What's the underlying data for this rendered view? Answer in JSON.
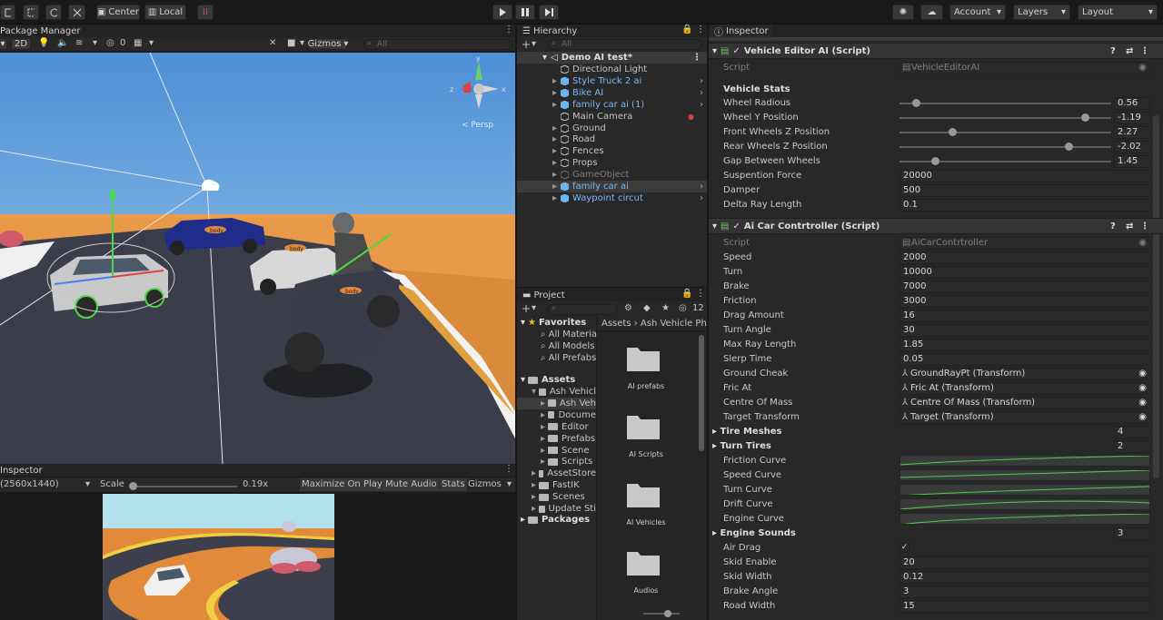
{
  "toolbar": {
    "center": "Center",
    "local": "Local",
    "account": "Account",
    "layers": "Layers",
    "layout": "Layout"
  },
  "scene": {
    "tab": "Package Manager",
    "mode2d": "2D",
    "gizmos": "Gizmos",
    "search": "All",
    "hidden_count": "0",
    "persp": "< Persp",
    "axis_x": "x",
    "axis_y": "y",
    "axis_z": "z",
    "car_label": "body"
  },
  "game": {
    "tab": "Inspector",
    "resolution": "(2560x1440)",
    "scale_label": "Scale",
    "scale_value": "0.19x",
    "maximize": "Maximize On Play",
    "mute": "Mute Audio",
    "stats": "Stats",
    "gizmos": "Gizmos"
  },
  "hierarchy": {
    "tab": "Hierarchy",
    "search": "All",
    "scene": "Demo AI test*",
    "items": [
      {
        "label": "Directional Light",
        "type": "go",
        "expand": false
      },
      {
        "label": "Style Truck 2 ai",
        "type": "prefab",
        "expand": true
      },
      {
        "label": "Bike AI",
        "type": "prefab",
        "expand": true
      },
      {
        "label": "family car ai (1)",
        "type": "prefab",
        "expand": true
      },
      {
        "label": "Main Camera",
        "type": "go",
        "expand": false
      },
      {
        "label": "Ground",
        "type": "go",
        "expand": true
      },
      {
        "label": "Road",
        "type": "go",
        "expand": true
      },
      {
        "label": "Fences",
        "type": "go",
        "expand": true
      },
      {
        "label": "Props",
        "type": "go",
        "expand": true
      },
      {
        "label": "GameObject",
        "type": "inactive",
        "expand": true
      },
      {
        "label": "family car ai",
        "type": "prefab",
        "expand": true
      },
      {
        "label": "Waypoint circut",
        "type": "prefab",
        "expand": true
      }
    ]
  },
  "project": {
    "tab": "Project",
    "count": "12",
    "favorites": "Favorites",
    "fav_items": [
      "All Materia",
      "All Models",
      "All Prefabs"
    ],
    "assets": "Assets",
    "tree": [
      {
        "label": "Ash Vehicl",
        "indent": 1
      },
      {
        "label": "Ash Veh",
        "indent": 2
      },
      {
        "label": "Docume",
        "indent": 2
      },
      {
        "label": "Editor",
        "indent": 2
      },
      {
        "label": "Prefabs",
        "indent": 2
      },
      {
        "label": "Scene",
        "indent": 2
      },
      {
        "label": "Scripts",
        "indent": 2
      },
      {
        "label": "AssetStore",
        "indent": 1
      },
      {
        "label": "FastIK",
        "indent": 1
      },
      {
        "label": "Scenes",
        "indent": 1
      },
      {
        "label": "Update Sti",
        "indent": 1
      }
    ],
    "packages": "Packages",
    "breadcrumb": [
      "Assets",
      "Ash Vehicle Ph"
    ],
    "folders": [
      "AI prefabs",
      "AI Scripts",
      "AI Vehicles",
      "Audios"
    ]
  },
  "inspector": {
    "tab": "Inspector",
    "comp1": {
      "title": "Vehicle Editor AI (Script)",
      "script_label": "Script",
      "script": "VehicleEditorAI",
      "section": "Vehicle Stats",
      "sliders": [
        {
          "label": "Wheel Radious",
          "value": "0.56",
          "pos": 0.06
        },
        {
          "label": "Wheel Y Position",
          "value": "-1.19",
          "pos": 0.86
        },
        {
          "label": "Front Wheels Z Position",
          "value": "2.27",
          "pos": 0.23
        },
        {
          "label": "Rear Wheels Z Position",
          "value": "-2.02",
          "pos": 0.78
        },
        {
          "label": "Gap Between Wheels",
          "value": "1.45",
          "pos": 0.15
        }
      ],
      "fields": [
        {
          "label": "Suspention Force",
          "value": "20000"
        },
        {
          "label": "Damper",
          "value": "500"
        },
        {
          "label": "Delta Ray Length",
          "value": "0.1"
        }
      ]
    },
    "comp2": {
      "title": "Ai Car Contrtroller (Script)",
      "script_label": "Script",
      "script": "AiCarContrtroller",
      "fields": [
        {
          "label": "Speed",
          "value": "2000"
        },
        {
          "label": "Turn",
          "value": "10000"
        },
        {
          "label": "Brake",
          "value": "7000"
        },
        {
          "label": "Friction",
          "value": "3000"
        },
        {
          "label": "Drag Amount",
          "value": "16"
        },
        {
          "label": "Turn Angle",
          "value": "30"
        },
        {
          "label": "Max Ray Length",
          "value": "1.85"
        },
        {
          "label": "Slerp Time",
          "value": "0.05"
        }
      ],
      "refs": [
        {
          "label": "Ground Cheak",
          "value": "GroundRayPt (Transform)"
        },
        {
          "label": "Fric At",
          "value": "Fric At (Transform)"
        },
        {
          "label": "Centre Of Mass",
          "value": "Centre Of Mass (Transform)"
        },
        {
          "label": "Target Transform",
          "value": "Target (Transform)"
        }
      ],
      "tire_meshes": {
        "label": "Tire Meshes",
        "count": "4"
      },
      "turn_tires": {
        "label": "Turn Tires",
        "count": "2"
      },
      "curves": [
        "Friction Curve",
        "Speed Curve",
        "Turn Curve",
        "Drift Curve",
        "Engine Curve"
      ],
      "engine_sounds": {
        "label": "Engine Sounds",
        "count": "3"
      },
      "air_drag": "Air Drag",
      "tail": [
        {
          "label": "Skid Enable",
          "value": "20"
        },
        {
          "label": "Skid Width",
          "value": "0.12"
        },
        {
          "label": "Brake Angle",
          "value": "3"
        },
        {
          "label": "Road Width",
          "value": "15"
        }
      ]
    }
  }
}
